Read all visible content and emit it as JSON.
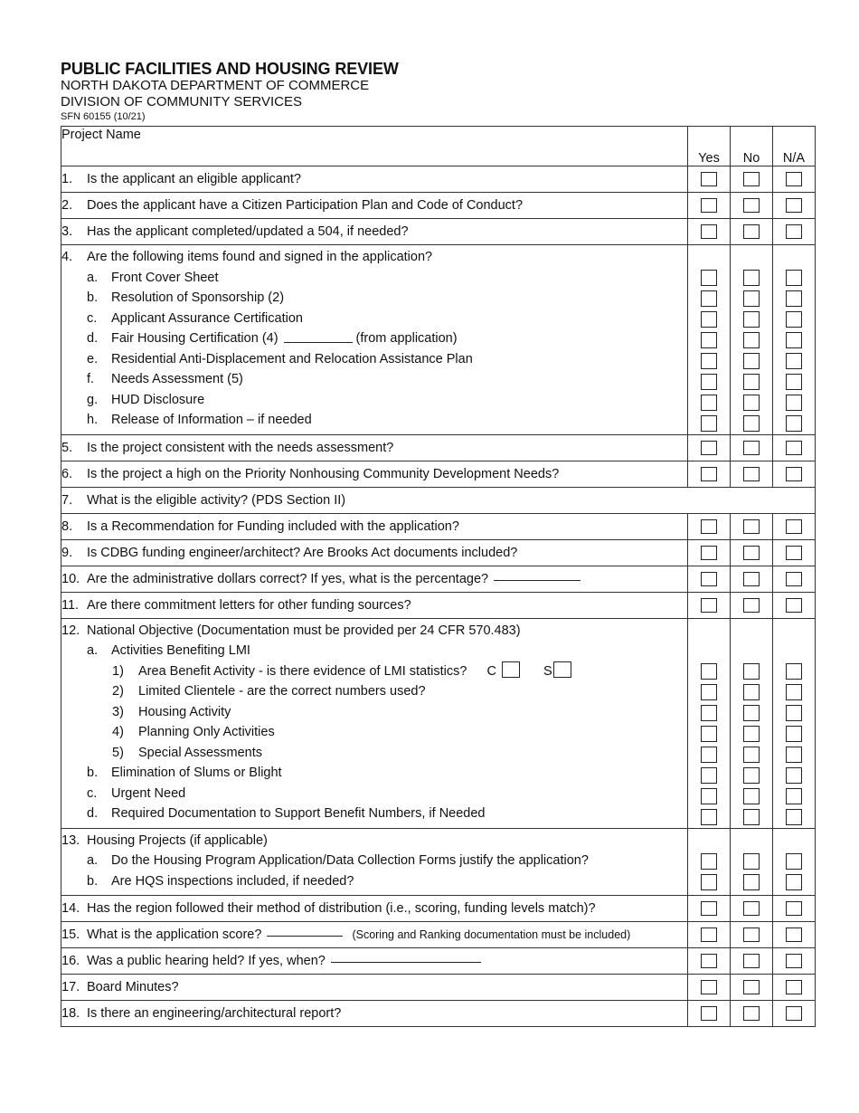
{
  "header": {
    "title": "PUBLIC FACILITIES AND HOUSING REVIEW",
    "department": "NORTH DAKOTA DEPARTMENT OF COMMERCE",
    "division": "DIVISION OF COMMUNITY SERVICES",
    "form_number": "SFN 60155 (10/21)"
  },
  "table": {
    "project_name_label": "Project Name",
    "project_name_value": "",
    "columns": [
      "Yes",
      "No",
      "N/A"
    ],
    "questions": [
      {
        "num": "1.",
        "text": "Is the applicant an eligible applicant?"
      },
      {
        "num": "2.",
        "text": "Does the applicant have a Citizen Participation Plan and Code of Conduct?"
      },
      {
        "num": "3.",
        "text": "Has the applicant completed/updated a 504, if needed?"
      },
      {
        "num": "4.",
        "text": "Are the following items found and signed in the application?",
        "items": [
          {
            "num": "a.",
            "text": "Front Cover Sheet"
          },
          {
            "num": "b.",
            "text": "Resolution of Sponsorship (2)"
          },
          {
            "num": "c.",
            "text": "Applicant Assurance Certification"
          },
          {
            "num": "d.",
            "text": "Fair Housing Certification (4)",
            "suffix": "(from application)"
          },
          {
            "num": "e.",
            "text": "Residential Anti-Displacement and Relocation Assistance Plan"
          },
          {
            "num": "f.",
            "text": "Needs Assessment (5)"
          },
          {
            "num": "g.",
            "text": "HUD Disclosure"
          },
          {
            "num": "h.",
            "text": "Release of Information – if needed"
          }
        ]
      },
      {
        "num": "5.",
        "text": "Is the project consistent with the needs assessment?"
      },
      {
        "num": "6.",
        "text": "Is the project a high on the Priority Nonhousing Community Development Needs?"
      },
      {
        "num": "7.",
        "text": "What is the eligible activity? (PDS Section II)"
      },
      {
        "num": "8.",
        "text": "Is a Recommendation for Funding included with the application?"
      },
      {
        "num": "9.",
        "text": "Is CDBG funding engineer/architect?  Are Brooks Act documents included?"
      },
      {
        "num": "10.",
        "text": "Are the administrative dollars correct?  If yes, what is the percentage?"
      },
      {
        "num": "11.",
        "text": "Are there commitment letters for other funding sources?"
      },
      {
        "num": "12.",
        "text": "National Objective (Documentation must be provided per 24 CFR 570.483)",
        "items": [
          {
            "num": "a.",
            "text": "Activities Benefiting LMI",
            "subitems": [
              {
                "num": "1)",
                "text": "Area Benefit Activity - is there evidence of LMI statistics?",
                "c_label": "C",
                "s_label": "S"
              },
              {
                "num": "2)",
                "text": "Limited Clientele - are the correct numbers used?"
              },
              {
                "num": "3)",
                "text": "Housing Activity"
              },
              {
                "num": "4)",
                "text": "Planning Only Activities"
              },
              {
                "num": "5)",
                "text": "Special Assessments"
              }
            ]
          },
          {
            "num": "b.",
            "text": "Elimination of Slums or Blight"
          },
          {
            "num": "c.",
            "text": "Urgent Need"
          },
          {
            "num": "d.",
            "text": "Required Documentation to Support Benefit Numbers, if Needed"
          }
        ]
      },
      {
        "num": "13.",
        "text": "Housing Projects (if applicable)",
        "items": [
          {
            "num": "a.",
            "text": "Do the Housing Program Application/Data Collection Forms justify the application?"
          },
          {
            "num": "b.",
            "text": "Are HQS inspections included, if needed?"
          }
        ]
      },
      {
        "num": "14.",
        "text": "Has the region followed their method of distribution (i.e., scoring, funding levels match)?"
      },
      {
        "num": "15.",
        "text": "What is the application score?",
        "note": "(Scoring and Ranking documentation must be included)"
      },
      {
        "num": "16.",
        "text": "Was a public hearing held?  If yes, when?"
      },
      {
        "num": "17.",
        "text": "Board Minutes?"
      },
      {
        "num": "18.",
        "text": "Is there an engineering/architectural report?"
      }
    ]
  }
}
